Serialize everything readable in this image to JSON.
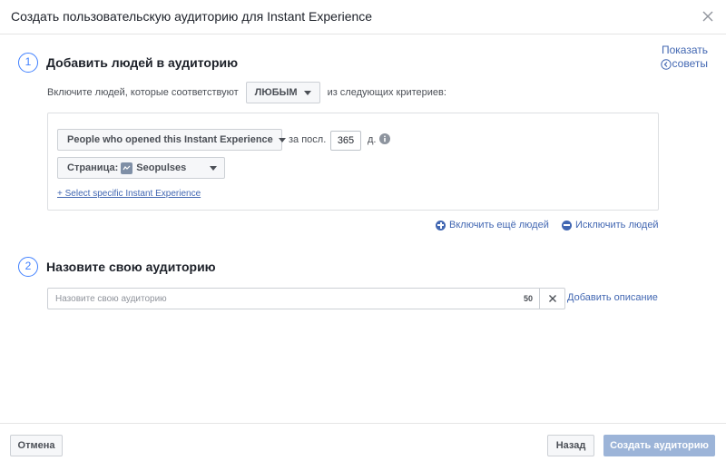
{
  "dialog": {
    "title": "Создать пользовательскую аудиторию для Instant Experience",
    "close_icon": "close-icon"
  },
  "tips": {
    "line1": "Показать",
    "line2": "советы",
    "icon": "chevron-left-circle-icon"
  },
  "step1": {
    "number": "1",
    "title": "Добавить людей в аудиторию",
    "include_prefix": "Включите людей, которые соответствуют",
    "match_value": "ЛЮБЫМ",
    "include_suffix": "из следующих критериев:",
    "criteria": {
      "event_dropdown": "People who opened this Instant Experience",
      "period_label": "за посл.",
      "days_value": "365",
      "days_unit": "д.",
      "page_label": "Страница:",
      "page_value": "Seopulses",
      "select_link": "+ Select specific Instant Experience"
    },
    "include_more": "Включить ещё людей",
    "exclude": "Исключить людей"
  },
  "step2": {
    "number": "2",
    "title": "Назовите свою аудиторию",
    "name_placeholder": "Назовите свою аудиторию",
    "char_limit": "50",
    "add_description": "Добавить описание"
  },
  "footer": {
    "cancel": "Отмена",
    "back": "Назад",
    "create": "Создать аудиторию"
  },
  "colors": {
    "accent": "#4080ff",
    "link": "#4267b2",
    "disabled_primary": "#9cb4d8"
  }
}
